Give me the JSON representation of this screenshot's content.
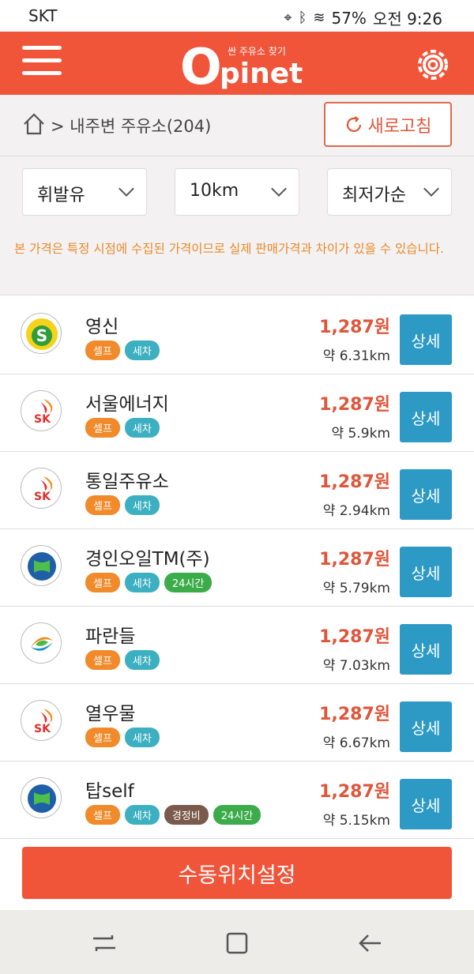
{
  "status": {
    "carrier": "SKT",
    "battery": "57%",
    "time": "오전 9:26"
  },
  "header": {
    "logo_tag": "싼 주유소 찾기",
    "logo_first": "O",
    "logo_rest": "pinet"
  },
  "breadcrumb": {
    "text": "> 내주변 주유소(204)",
    "refresh_label": "새로고침"
  },
  "filters": {
    "fuel": "휘발유",
    "radius": "10km",
    "sort": "최저가순"
  },
  "notice": "본 가격은 특정 시점에 수집된 가격이므로 실제 판매가격과 차이가 있을 수 있습니다.",
  "stations": [
    {
      "name": "영신",
      "brand": "s-oil",
      "price": "1,287원",
      "distance": "약 6.31km",
      "badges": [
        "셀프",
        "세차"
      ]
    },
    {
      "name": "서울에너지",
      "brand": "sk",
      "price": "1,287원",
      "distance": "약 5.9km",
      "badges": [
        "셀프",
        "세차"
      ]
    },
    {
      "name": "통일주유소",
      "brand": "sk",
      "price": "1,287원",
      "distance": "약 2.94km",
      "badges": [
        "셀프",
        "세차"
      ]
    },
    {
      "name": "경인오일TM(주)",
      "brand": "hyundai",
      "price": "1,287원",
      "distance": "약 5.79km",
      "badges": [
        "셀프",
        "세차",
        "24시간"
      ]
    },
    {
      "name": "파란들",
      "brand": "gs",
      "price": "1,287원",
      "distance": "약 7.03km",
      "badges": [
        "셀프",
        "세차"
      ]
    },
    {
      "name": "열우물",
      "brand": "sk",
      "price": "1,287원",
      "distance": "약 6.67km",
      "badges": [
        "셀프",
        "세차"
      ]
    },
    {
      "name": "탑self",
      "brand": "hyundai",
      "price": "1,287원",
      "distance": "약 5.15km",
      "badges": [
        "셀프",
        "세차",
        "경정비",
        "24시간"
      ]
    }
  ],
  "detail_label": "상세",
  "bottom_button": "수동위치설정",
  "colors": {
    "accent": "#f0553a",
    "detail": "#2d9ac6",
    "price": "#e0553a"
  }
}
